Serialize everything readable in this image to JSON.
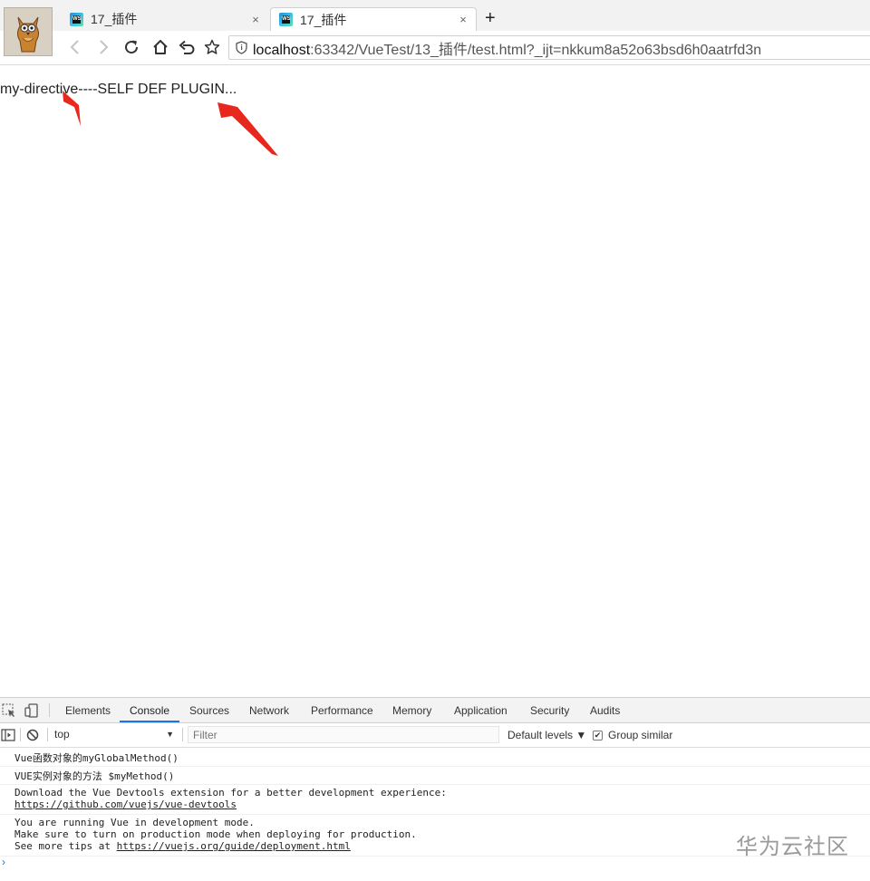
{
  "browser": {
    "tabs": [
      {
        "title": "17_插件",
        "close": "×",
        "active": false
      },
      {
        "title": "17_插件",
        "close": "×",
        "active": true
      }
    ],
    "new_tab": "+",
    "url": {
      "host": "localhost",
      "rest": ":63342/VueTest/13_插件/test.html?_ijt=nkkum8a52o63bsd6h0aatrfd3n"
    }
  },
  "page": {
    "text": "my-directive----SELF DEF PLUGIN..."
  },
  "devtools": {
    "tabs": [
      "Elements",
      "Console",
      "Sources",
      "Network",
      "Performance",
      "Memory",
      "Application",
      "Security",
      "Audits"
    ],
    "active_tab": "Console",
    "context": "top",
    "filter_placeholder": "Filter",
    "levels": "Default levels ▼",
    "group_similar": "Group similar",
    "messages": {
      "m1": "Vue函数对象的myGlobalMethod()",
      "m2": "VUE实例对象的方法 $myMethod()",
      "m3_line1": "Download the Vue Devtools extension for a better development experience:",
      "m3_link": "https://github.com/vuejs/vue-devtools",
      "m4_line1": "You are running Vue in development mode.",
      "m4_line2": "Make sure to turn on production mode when deploying for production.",
      "m4_line3_prefix": "See more tips at ",
      "m4_link": "https://vuejs.org/guide/deployment.html"
    },
    "prompt": "›"
  },
  "watermark": "华为云社区",
  "colors": {
    "annotation_arrow": "#e8281c",
    "active_tab_underline": "#1a73e8"
  }
}
